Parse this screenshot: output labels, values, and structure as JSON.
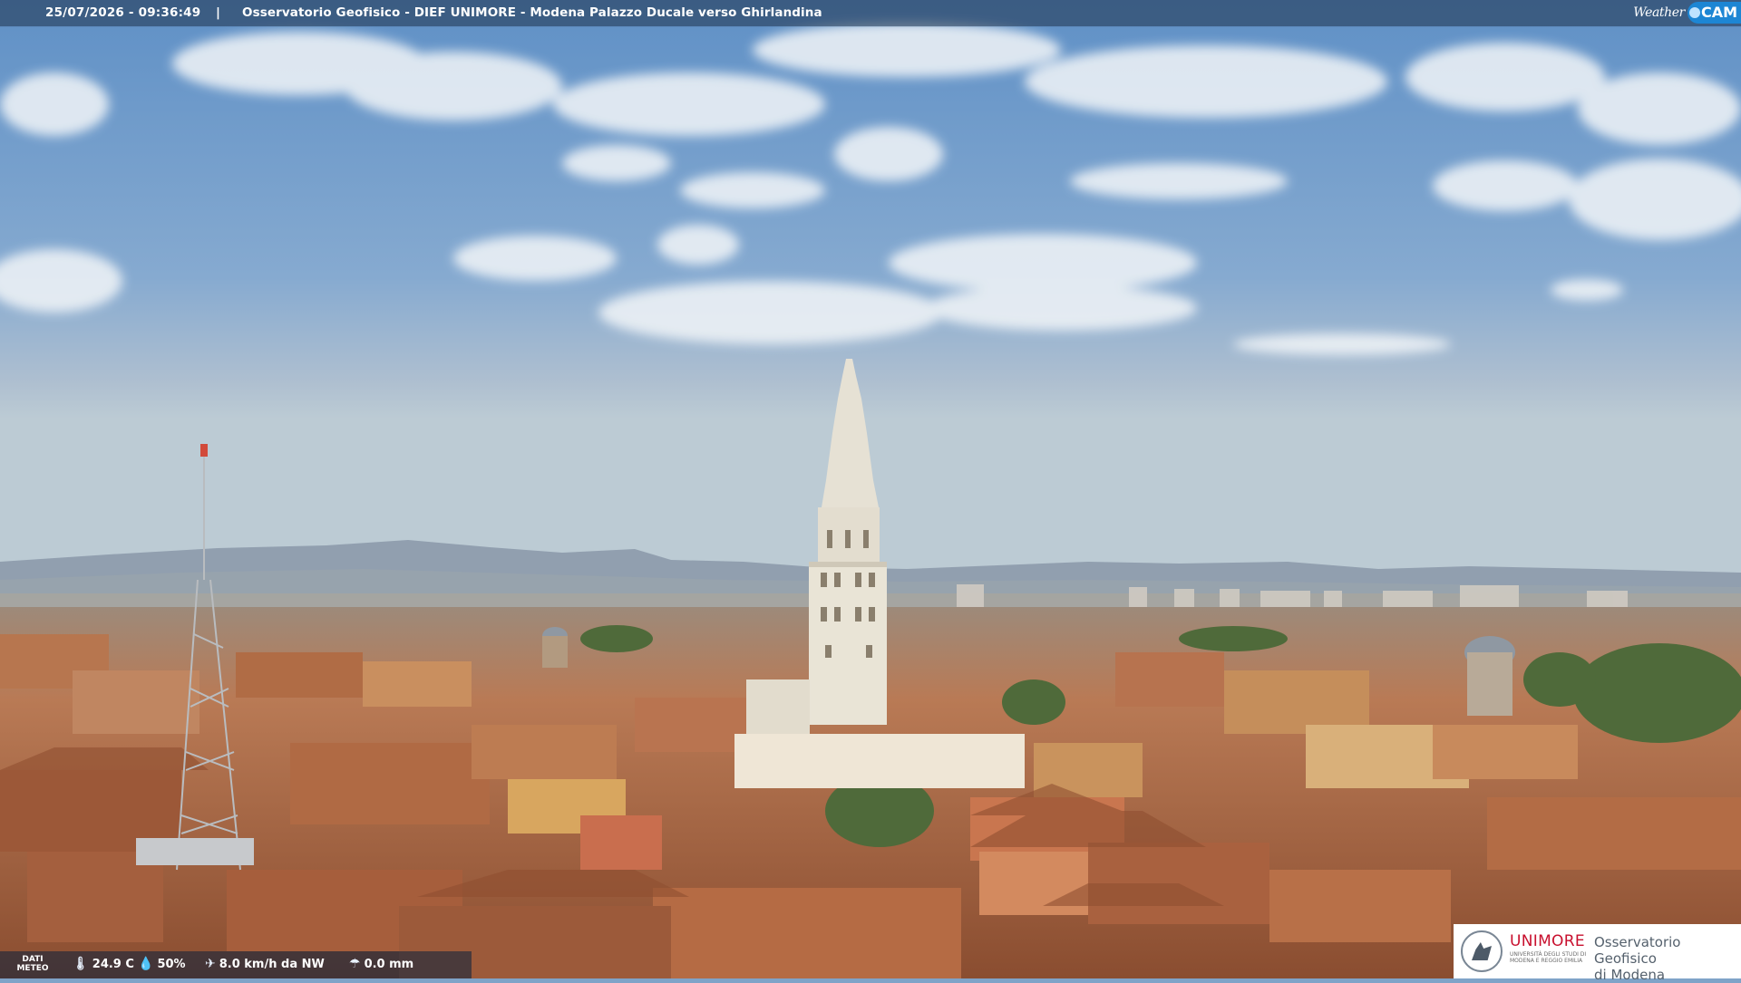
{
  "overlay": {
    "timestamp": "25/07/2026 - 09:36:49",
    "separator": "|",
    "title": "Osservatorio Geofisico - DIEF UNIMORE - Modena Palazzo Ducale verso Ghirlandina",
    "brand_word": "Weather",
    "brand_cam": "CAM"
  },
  "weather": {
    "label": "DATI METEO",
    "temperature": "24.9 C",
    "humidity": "50%",
    "wind": "8.0 km/h da NW",
    "rain": "0.0 mm"
  },
  "logo": {
    "name": "UNIMORE",
    "subtitle": "UNIVERSITÀ DEGLI STUDI DI MODENA E REGGIO EMILIA",
    "observatory_line1": "Osservatorio Geofisico",
    "observatory_line2": "di Modena"
  },
  "colors": {
    "sky_top": "#6f9ccd",
    "sky_horizon": "#b9c8d2",
    "roofs": "#b8714a",
    "tower": "#e9e4d6"
  },
  "icons": {
    "temperature": "thermometer-icon",
    "humidity": "droplet-icon",
    "wind": "wind-icon",
    "rain": "rain-gauge-icon"
  }
}
